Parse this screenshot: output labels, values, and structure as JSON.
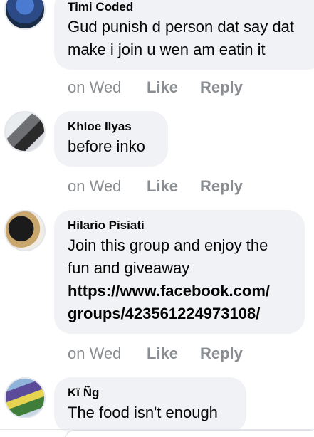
{
  "comments": [
    {
      "author": "Timi Coded",
      "lines": [
        "Gud punish d person dat say dat",
        "make i join u wen am eatin it"
      ],
      "time": "on Wed",
      "like": "Like",
      "reply": "Reply"
    },
    {
      "author": "Khloe Ilyas",
      "lines": [
        "before inko"
      ],
      "time": "on Wed",
      "like": "Like",
      "reply": "Reply"
    },
    {
      "author": "Hilario Pisiati",
      "lines": [
        "Join this group and enjoy the",
        "fun and giveaway"
      ],
      "link_lines": [
        "https://www.facebook.com/",
        "groups/423561224973108/"
      ],
      "time": "on Wed",
      "like": "Like",
      "reply": "Reply"
    },
    {
      "author": "Kï Ñg",
      "lines": [
        "The food isn't enough"
      ]
    }
  ],
  "colors": {
    "bubble": "#f0f2f5",
    "meta_text": "#8a8d91",
    "primary_text": "#050505"
  },
  "icons": {
    "avatar_timi": "avatar-photo",
    "avatar_khloe": "avatar-photo",
    "avatar_hilario": "avatar-photo",
    "avatar_king": "avatar-photo"
  }
}
